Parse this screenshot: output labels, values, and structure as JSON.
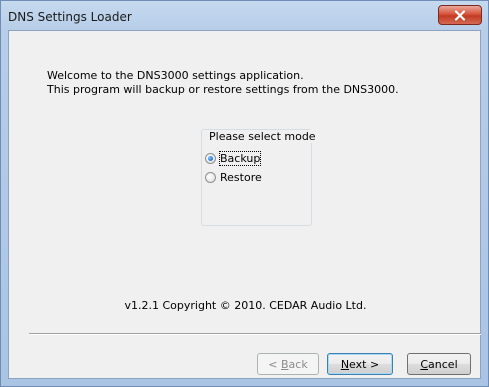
{
  "window": {
    "title": "DNS Settings Loader"
  },
  "content": {
    "welcome_line1": "Welcome to the DNS3000 settings application.",
    "welcome_line2": "This program will backup or restore settings from the DNS3000."
  },
  "mode": {
    "legend": "Please select mode",
    "options": [
      {
        "label": "Backup",
        "selected": true
      },
      {
        "label": "Restore",
        "selected": false
      }
    ]
  },
  "footer": {
    "copyright": "v1.2.1 Copyright © 2010. CEDAR Audio Ltd."
  },
  "buttons": {
    "back": {
      "prefix": "< ",
      "mnemonic": "B",
      "rest": "ack",
      "enabled": false
    },
    "next": {
      "mnemonic": "N",
      "rest": "ext >",
      "enabled": true
    },
    "cancel": {
      "mnemonic": "C",
      "rest": "ancel",
      "enabled": true
    }
  },
  "icons": {
    "close": "close-icon"
  },
  "colors": {
    "close_button": "#d6533c",
    "client_bg": "#f0f0f0"
  }
}
